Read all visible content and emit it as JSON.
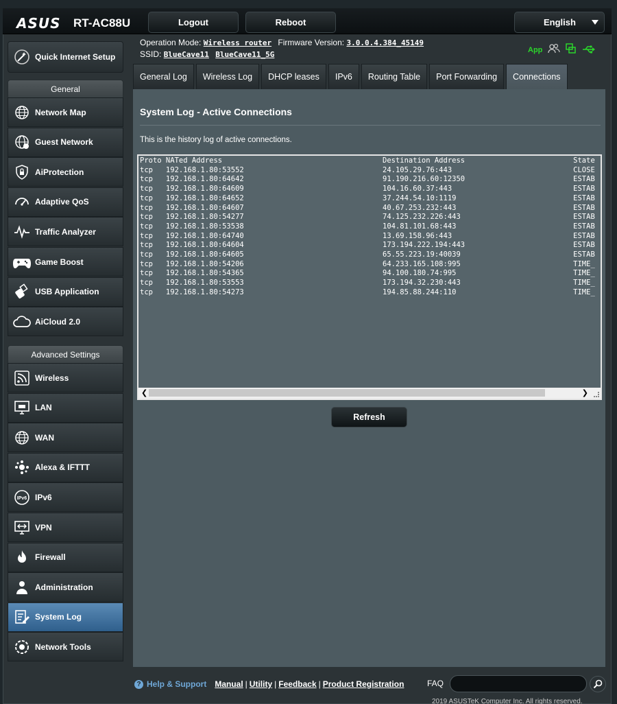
{
  "header": {
    "brand": "ASUS",
    "model": "RT-AC88U",
    "logout_label": "Logout",
    "reboot_label": "Reboot",
    "language": "English"
  },
  "info": {
    "op_mode_label": "Operation Mode:",
    "op_mode_value": "Wireless router",
    "firmware_label": "Firmware Version:",
    "firmware_value": "3.0.0.4.384_45149",
    "ssid_label": "SSID:",
    "ssid_1": "BlueCave11",
    "ssid_2": "BlueCave11_5G",
    "app_label": "App"
  },
  "sidebar": {
    "quick_setup": "Quick Internet Setup",
    "general_header": "General",
    "general_items": [
      {
        "label": "Network Map",
        "icon": "globe-network-icon"
      },
      {
        "label": "Guest Network",
        "icon": "guest-globe-icon"
      },
      {
        "label": "AiProtection",
        "icon": "lock-shield-icon"
      },
      {
        "label": "Adaptive QoS",
        "icon": "speedometer-icon"
      },
      {
        "label": "Traffic Analyzer",
        "icon": "pulse-graph-icon"
      },
      {
        "label": "Game Boost",
        "icon": "gamepad-icon"
      },
      {
        "label": "USB Application",
        "icon": "usb-puzzle-icon"
      },
      {
        "label": "AiCloud 2.0",
        "icon": "cloud-icon"
      }
    ],
    "advanced_header": "Advanced Settings",
    "advanced_items": [
      {
        "label": "Wireless",
        "icon": "wifi-icon"
      },
      {
        "label": "LAN",
        "icon": "lan-monitor-icon"
      },
      {
        "label": "WAN",
        "icon": "wan-globe-icon"
      },
      {
        "label": "Alexa & IFTTT",
        "icon": "alexa-icon"
      },
      {
        "label": "IPv6",
        "icon": "ipv6-icon"
      },
      {
        "label": "VPN",
        "icon": "vpn-monitor-icon"
      },
      {
        "label": "Firewall",
        "icon": "flame-icon"
      },
      {
        "label": "Administration",
        "icon": "admin-person-icon"
      },
      {
        "label": "System Log",
        "icon": "log-pencil-icon"
      },
      {
        "label": "Network Tools",
        "icon": "toolbox-gear-icon"
      }
    ],
    "active_item": "System Log"
  },
  "tabs": [
    "General Log",
    "Wireless Log",
    "DHCP leases",
    "IPv6",
    "Routing Table",
    "Port Forwarding",
    "Connections"
  ],
  "active_tab": "Connections",
  "main": {
    "title": "System Log - Active Connections",
    "description": "This is the history log of active connections.",
    "refresh_label": "Refresh"
  },
  "connections": {
    "headers": [
      "Proto",
      "NATed Address",
      "Destination Address",
      "State"
    ],
    "rows": [
      [
        "tcp",
        "192.168.1.80:53552",
        "24.105.29.76:443",
        "CLOSE"
      ],
      [
        "tcp",
        "192.168.1.80:64642",
        "91.190.216.60:12350",
        "ESTAB"
      ],
      [
        "tcp",
        "192.168.1.80:64609",
        "104.16.60.37:443",
        "ESTAB"
      ],
      [
        "tcp",
        "192.168.1.80:64652",
        "37.244.54.10:1119",
        "ESTAB"
      ],
      [
        "tcp",
        "192.168.1.80:64607",
        "40.67.253.232:443",
        "ESTAB"
      ],
      [
        "tcp",
        "192.168.1.80:54277",
        "74.125.232.226:443",
        "ESTAB"
      ],
      [
        "tcp",
        "192.168.1.80:53538",
        "104.81.101.68:443",
        "ESTAB"
      ],
      [
        "tcp",
        "192.168.1.80:64740",
        "13.69.158.96:443",
        "ESTAB"
      ],
      [
        "tcp",
        "192.168.1.80:64604",
        "173.194.222.194:443",
        "ESTAB"
      ],
      [
        "tcp",
        "192.168.1.80:64605",
        "65.55.223.19:40039",
        "ESTAB"
      ],
      [
        "tcp",
        "192.168.1.80:54206",
        "64.233.165.108:995",
        "TIME_"
      ],
      [
        "tcp",
        "192.168.1.80:54365",
        "94.100.180.74:995",
        "TIME_"
      ],
      [
        "tcp",
        "192.168.1.80:53553",
        "173.194.32.230:443",
        "TIME_"
      ],
      [
        "tcp",
        "192.168.1.80:54273",
        "194.85.88.244:110",
        "TIME_"
      ]
    ]
  },
  "footer": {
    "help_label": "Help & Support",
    "links": [
      "Manual",
      "Utility",
      "Feedback",
      "Product Registration"
    ],
    "faq_label": "FAQ",
    "copyright": "2019 ASUSTeK Computer Inc. All rights reserved."
  },
  "colors": {
    "accent": "#6fa7d6",
    "app_green": "#2bd62b",
    "active_nav": "#3d6d99"
  }
}
